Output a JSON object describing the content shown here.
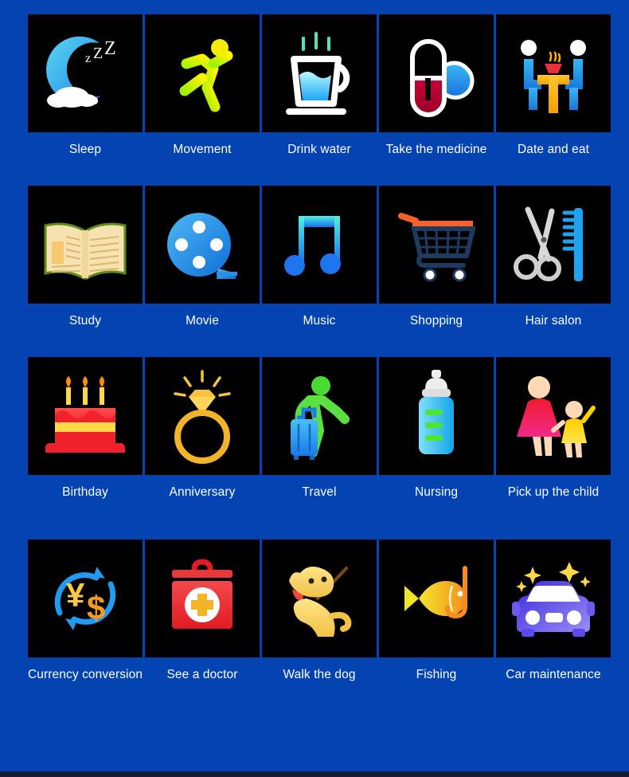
{
  "page": {
    "background_color": "#0444b2",
    "tile_background_color": "#000000",
    "label_color": "#ffffff",
    "bottom_bar_color": "#141a33",
    "columns": 5,
    "rows": 4
  },
  "grid": {
    "items": [
      {
        "label": "Sleep",
        "icon": "moon-zzz-icon"
      },
      {
        "label": "Movement",
        "icon": "running-person-icon"
      },
      {
        "label": "Drink water",
        "icon": "water-glass-icon"
      },
      {
        "label": "Take the medicine",
        "icon": "pills-capsule-icon"
      },
      {
        "label": "Date and eat",
        "icon": "two-people-dining-icon"
      },
      {
        "label": "Study",
        "icon": "open-book-icon"
      },
      {
        "label": "Movie",
        "icon": "film-reel-icon"
      },
      {
        "label": "Music",
        "icon": "music-note-icon"
      },
      {
        "label": "Shopping",
        "icon": "shopping-cart-icon"
      },
      {
        "label": "Hair salon",
        "icon": "scissors-comb-icon"
      },
      {
        "label": "Birthday",
        "icon": "birthday-cake-icon"
      },
      {
        "label": "Anniversary",
        "icon": "diamond-ring-icon"
      },
      {
        "label": "Travel",
        "icon": "traveler-suitcase-icon"
      },
      {
        "label": "Nursing",
        "icon": "baby-bottle-icon"
      },
      {
        "label": "Pick up the child",
        "icon": "parent-and-child-icon"
      },
      {
        "label": "Currency conversion",
        "icon": "currency-exchange-icon"
      },
      {
        "label": "See a doctor",
        "icon": "first-aid-kit-icon"
      },
      {
        "label": "Walk the dog",
        "icon": "dog-leash-icon"
      },
      {
        "label": "Fishing",
        "icon": "fish-hook-icon"
      },
      {
        "label": "Car maintenance",
        "icon": "sparkling-car-icon"
      }
    ]
  }
}
